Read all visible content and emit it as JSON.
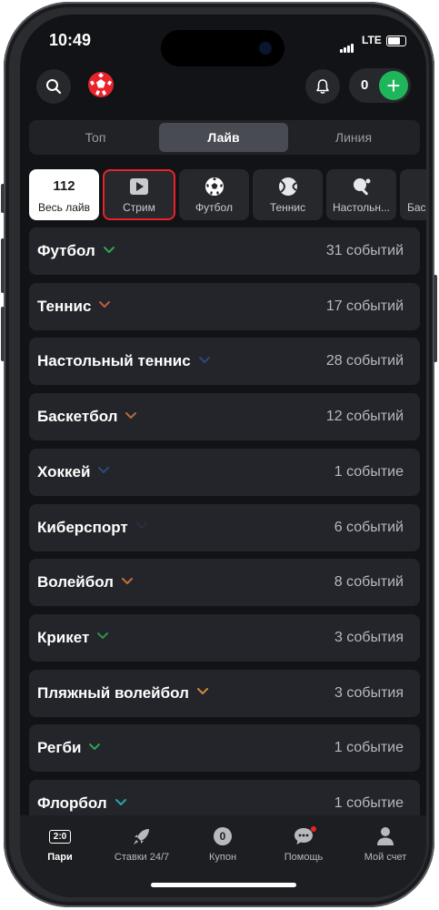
{
  "status": {
    "time": "10:49",
    "network": "LTE"
  },
  "header": {
    "balance": "0",
    "search_icon": "search-icon",
    "bell_icon": "bell-icon"
  },
  "tabs": [
    {
      "label": "Топ",
      "active": false
    },
    {
      "label": "Лайв",
      "active": true
    },
    {
      "label": "Линия",
      "active": false
    }
  ],
  "chips": {
    "all_live": {
      "count": "112",
      "label": "Весь лайв"
    },
    "items": [
      {
        "label": "Стрим",
        "icon": "play-icon",
        "selected": true
      },
      {
        "label": "Футбол",
        "icon": "soccer-ball-icon"
      },
      {
        "label": "Теннис",
        "icon": "tennis-ball-icon"
      },
      {
        "label": "Настольн...",
        "icon": "ping-pong-icon"
      },
      {
        "label": "Бас",
        "icon": "basketball-icon"
      }
    ]
  },
  "sports": [
    {
      "name": "Футбол",
      "count": "31 событий",
      "chevron_color": "#2ea44f"
    },
    {
      "name": "Теннис",
      "count": "17 событий",
      "chevron_color": "#c25b3a"
    },
    {
      "name": "Настольный теннис",
      "count": "28 событий",
      "chevron_color": "#2b4a78"
    },
    {
      "name": "Баскетбол",
      "count": "12 событий",
      "chevron_color": "#b86a34"
    },
    {
      "name": "Хоккей",
      "count": "1 событие",
      "chevron_color": "#2b4a78"
    },
    {
      "name": "Киберспорт",
      "count": "6 событий",
      "chevron_color": "#2a2d40"
    },
    {
      "name": "Волейбол",
      "count": "8 событий",
      "chevron_color": "#c2703a"
    },
    {
      "name": "Крикет",
      "count": "3 события",
      "chevron_color": "#2e8f4a"
    },
    {
      "name": "Пляжный волейбол",
      "count": "3 события",
      "chevron_color": "#c98a3a"
    },
    {
      "name": "Регби",
      "count": "1 событие",
      "chevron_color": "#2ea44f"
    },
    {
      "name": "Флорбол",
      "count": "1 событие",
      "chevron_color": "#2aa6a0"
    }
  ],
  "tabbar": [
    {
      "label": "Пари",
      "icon_text": "2:0",
      "active": true
    },
    {
      "label": "Ставки 24/7",
      "icon": "rocket-icon"
    },
    {
      "label": "Купон",
      "icon_text": "0"
    },
    {
      "label": "Помощь",
      "icon": "chat-icon"
    },
    {
      "label": "Мой счет",
      "icon": "user-icon"
    }
  ],
  "colors": {
    "accent_red": "#e8232b",
    "accent_green": "#1fb55a",
    "bg": "#121316",
    "card": "#23252a"
  }
}
